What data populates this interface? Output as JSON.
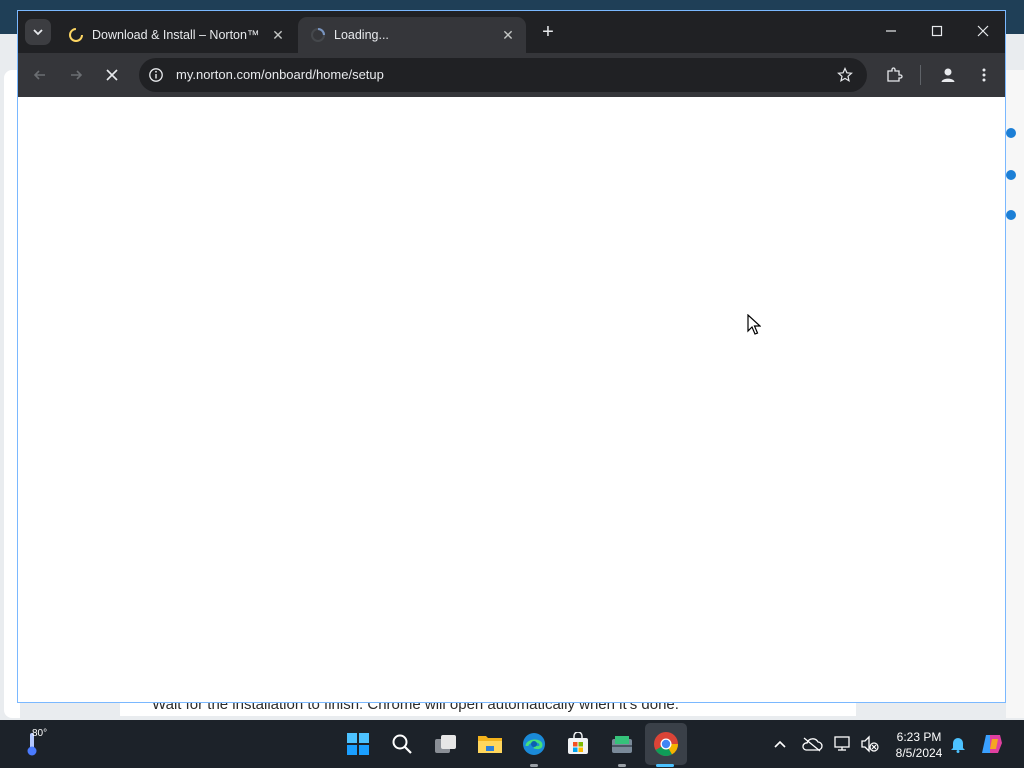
{
  "background_page": {
    "instruction_text": "Wait for the installation to finish. Chrome will open automatically when it’s done."
  },
  "browser": {
    "tabs": [
      {
        "title": "Download & Install – Norton™",
        "favicon": "loading-spinner-icon",
        "active": false
      },
      {
        "title": "Loading...",
        "favicon": "loading-spinner-icon",
        "active": true
      }
    ],
    "address_bar": {
      "url": "my.norton.com/onboard/home/setup"
    },
    "colors": {
      "frame": "#202124",
      "toolbar": "#35363a",
      "accent_border": "#7ab8ff",
      "spinner": "#fdd663"
    }
  },
  "taskbar": {
    "weather": {
      "temperature": "80°",
      "icon": "thermometer-icon"
    },
    "pinned_apps": [
      {
        "name": "start",
        "icon": "windows-start-icon"
      },
      {
        "name": "search",
        "icon": "search-icon"
      },
      {
        "name": "task-view",
        "icon": "task-view-icon"
      },
      {
        "name": "file-explorer",
        "icon": "folder-icon"
      },
      {
        "name": "edge",
        "icon": "edge-icon"
      },
      {
        "name": "microsoft-store",
        "icon": "store-icon"
      },
      {
        "name": "installer",
        "icon": "installer-icon"
      },
      {
        "name": "chrome",
        "icon": "chrome-icon"
      }
    ],
    "tray": {
      "time": "6:23 PM",
      "date": "8/5/2024"
    }
  }
}
